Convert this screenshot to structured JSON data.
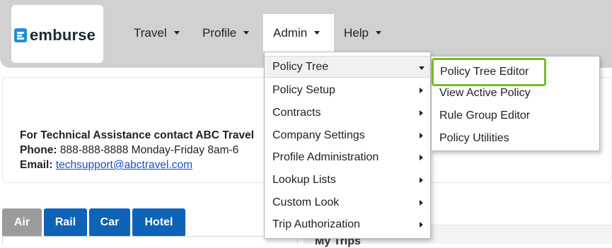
{
  "brand": {
    "logo_text": "emburse",
    "logo_icon": "emburse-logo-icon",
    "logo_color": "#1f8fd6"
  },
  "nav": {
    "items": [
      {
        "label": "Travel"
      },
      {
        "label": "Profile"
      },
      {
        "label": "Admin"
      },
      {
        "label": "Help"
      }
    ]
  },
  "contact": {
    "heading": "For Technical Assistance contact ABC Travel",
    "phone_label": "Phone:",
    "phone_value": "888-888-8888 Monday-Friday 8am-6",
    "email_label": "Email:",
    "email_value": "techsupport@abctravel.com"
  },
  "tabs": [
    {
      "label": "Air",
      "active": true
    },
    {
      "label": "Rail",
      "active": false
    },
    {
      "label": "Car",
      "active": false
    },
    {
      "label": "Hotel",
      "active": false
    }
  ],
  "my_trips": {
    "title": "My Trips"
  },
  "admin_menu": {
    "items": [
      {
        "label": "Policy Tree",
        "expanded": true
      },
      {
        "label": "Policy Setup"
      },
      {
        "label": "Contracts"
      },
      {
        "label": "Company Settings"
      },
      {
        "label": "Profile Administration"
      },
      {
        "label": "Lookup Lists"
      },
      {
        "label": "Custom Look"
      },
      {
        "label": "Trip Authorization"
      }
    ]
  },
  "policy_tree_submenu": {
    "items": [
      {
        "label": "Policy Tree Editor",
        "highlighted": true
      },
      {
        "label": "View Active Policy"
      },
      {
        "label": "Rule Group Editor"
      },
      {
        "label": "Policy Utilities"
      }
    ]
  },
  "colors": {
    "topbar": "#d1d1d1",
    "tab_blue": "#0e63b6",
    "tab_active": "#9b9b9b",
    "highlight_green": "#79b829",
    "link": "#1a4fc4"
  }
}
